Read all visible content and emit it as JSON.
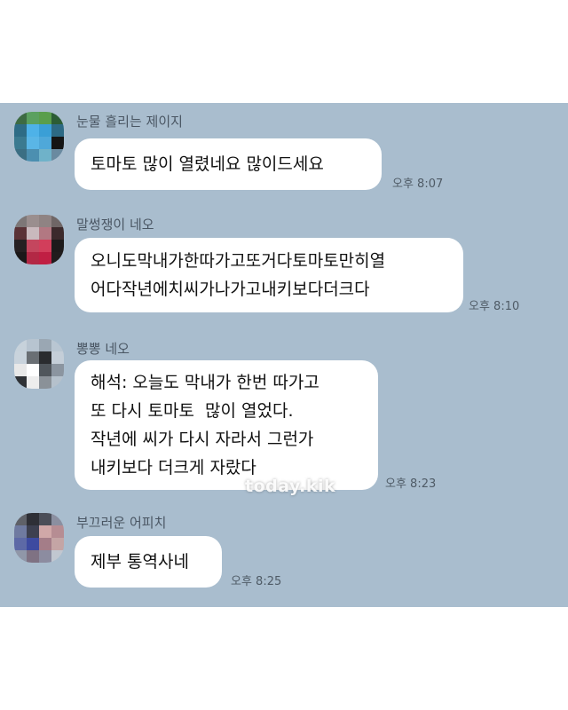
{
  "watermark": "today.kik",
  "messages": [
    {
      "sender": "눈물 흘리는 제이지",
      "text": "토마토 많이 열렸네요 많이드세요",
      "time": "오후 8:07",
      "avatar_colors": [
        "#3d6b43",
        "#5ba060",
        "#5a9e4c",
        "#2c5d35",
        "#2e6c86",
        "#4eb2e8",
        "#3a9fd6",
        "#2d6a85",
        "#3b7a90",
        "#5ab6e6",
        "#4fa8d9",
        "#151515",
        "#3b6e83",
        "#4c8fb0",
        "#6fb2c9",
        "#6a8aa0"
      ]
    },
    {
      "sender": "말썽쟁이 네오",
      "text": "오니도막내가한따가고또거다토마토만히열\n어다작년에치씨가나가고내키보다더크다",
      "time": "오후 8:10",
      "avatar_colors": [
        "#7d7777",
        "#9a8e8e",
        "#8f8383",
        "#6f6666",
        "#5a3236",
        "#c9b9bd",
        "#b27882",
        "#3c2a2c",
        "#262022",
        "#c4465e",
        "#d23e5b",
        "#1d1a1b",
        "#1b1819",
        "#b32845",
        "#c01f43",
        "#201c1d"
      ]
    },
    {
      "sender": "뽕뽕 네오",
      "text": "해석: 오늘도 막내가 한번 따가고\n또 다시 토마토  많이 열었다.\n작년에 씨가 다시 자라서 그런가\n내키보다 더크게 자랐다",
      "time": "오후 8:23",
      "avatar_colors": [
        "#c7d2db",
        "#b7c4d0",
        "#9aa7b3",
        "#b9c6d2",
        "#c9d3dc",
        "#6a6f74",
        "#2a2c2f",
        "#c4ced8",
        "#e8e8e8",
        "#ffffff",
        "#50565c",
        "#8b95a0",
        "#2f3236",
        "#ededed",
        "#8a9198",
        "#b5c1cc"
      ]
    },
    {
      "sender": "부끄러운 어피치",
      "text": "제부 통역사네",
      "time": "오후 8:25",
      "avatar_colors": [
        "#5f6168",
        "#2e2f36",
        "#4b4e58",
        "#8b8fa0",
        "#6f7aa0",
        "#3d4050",
        "#d0a8a8",
        "#b68d93",
        "#5d69a6",
        "#3d4aa0",
        "#a47d88",
        "#c4a5a5",
        "#9097a8",
        "#7f7283",
        "#8c8ca0",
        "#c1c7d0"
      ]
    }
  ]
}
